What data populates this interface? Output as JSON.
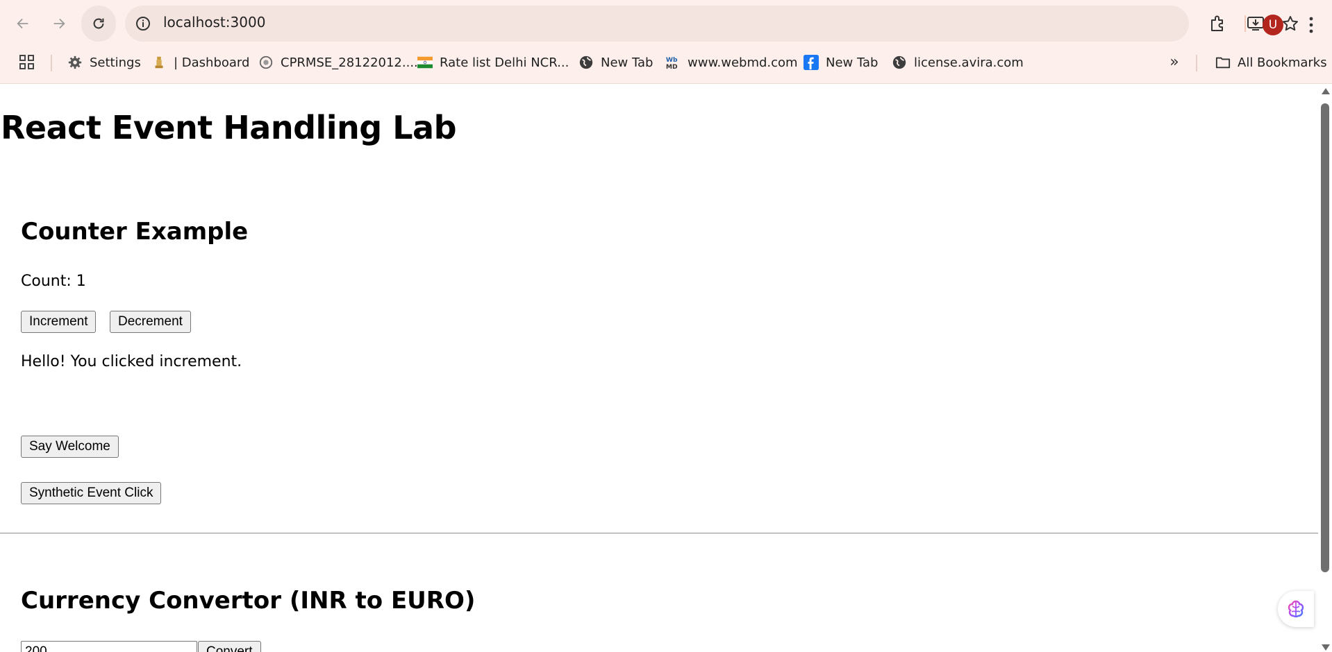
{
  "browser": {
    "url": "localhost:3000",
    "avatar_letter": "U",
    "bookmarks": [
      {
        "label": "Settings",
        "icon": "gear-icon"
      },
      {
        "label": "| Dashboard",
        "icon": "emblem-icon"
      },
      {
        "label": "CPRMSE_28122012....",
        "icon": "seal-icon"
      },
      {
        "label": "Rate list Delhi NCR...",
        "icon": "india-flag-icon"
      },
      {
        "label": "New Tab",
        "icon": "globe-icon"
      },
      {
        "label": "www.webmd.com",
        "icon": "webmd-icon"
      },
      {
        "label": "New Tab",
        "icon": "facebook-icon"
      },
      {
        "label": "license.avira.com",
        "icon": "globe-icon"
      }
    ],
    "all_bookmarks_label": "All Bookmarks"
  },
  "page": {
    "title": "React Event Handling Lab",
    "counter": {
      "heading": "Counter Example",
      "count_text": "Count: 1",
      "increment_label": "Increment",
      "decrement_label": "Decrement",
      "message": "Hello! You clicked increment."
    },
    "say_welcome_label": "Say Welcome",
    "synthetic_label": "Synthetic Event Click",
    "currency": {
      "heading": "Currency Convertor (INR to EURO)",
      "amount_value": "200",
      "convert_label": "Convert"
    }
  },
  "colors": {
    "chrome_bg": "#fdf0ec",
    "omnibox_bg": "#f3e4e0",
    "avatar_bg": "#b3261e"
  }
}
